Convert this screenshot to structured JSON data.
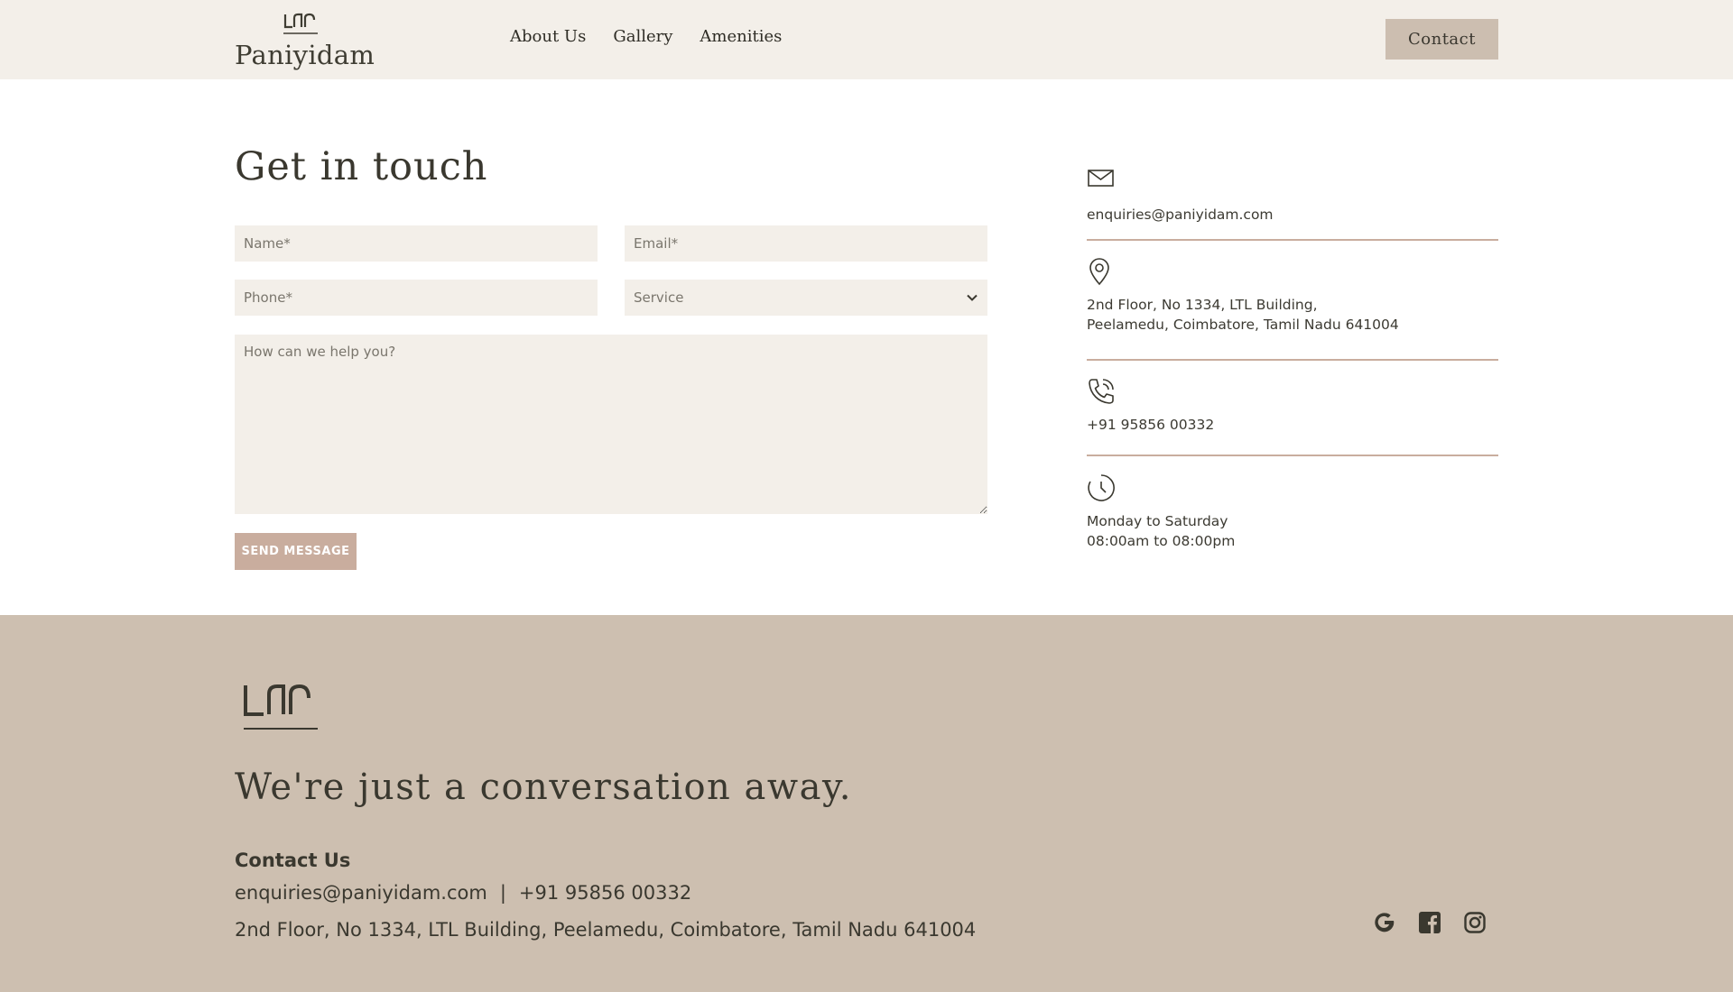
{
  "header": {
    "brand": "Paniyidam",
    "nav": [
      "About Us",
      "Gallery",
      "Amenities"
    ],
    "contact_label": "Contact"
  },
  "form": {
    "title": "Get in touch",
    "name_placeholder": "Name*",
    "email_placeholder": "Email*",
    "phone_placeholder": "Phone*",
    "service_selected": "Service",
    "message_placeholder": "How can we help you?",
    "send_label": "SEND MESSAGE"
  },
  "info": {
    "email": "enquiries@paniyidam.com",
    "address_line1": "2nd Floor, No 1334, LTL Building,",
    "address_line2": "Peelamedu, Coimbatore, Tamil Nadu 641004",
    "phone": "+91 95856 00332",
    "hours_line1": "Monday to Saturday",
    "hours_line2": "08:00am to 08:00pm"
  },
  "footer": {
    "tagline": "We're just a conversation away.",
    "heading": "Contact Us",
    "email": "enquiries@paniyidam.com",
    "separator": "|",
    "phone": "+91 95856 00332",
    "address": "2nd Floor, No 1334, LTL Building, Peelamedu, Coimbatore, Tamil Nadu 641004",
    "social_icons": [
      "google-icon",
      "facebook-icon",
      "instagram-icon"
    ]
  },
  "colors": {
    "header_bg": "#f3efe9",
    "footer_bg": "#cdbfb0",
    "accent": "#c9ad9e",
    "text": "#3a382f"
  }
}
